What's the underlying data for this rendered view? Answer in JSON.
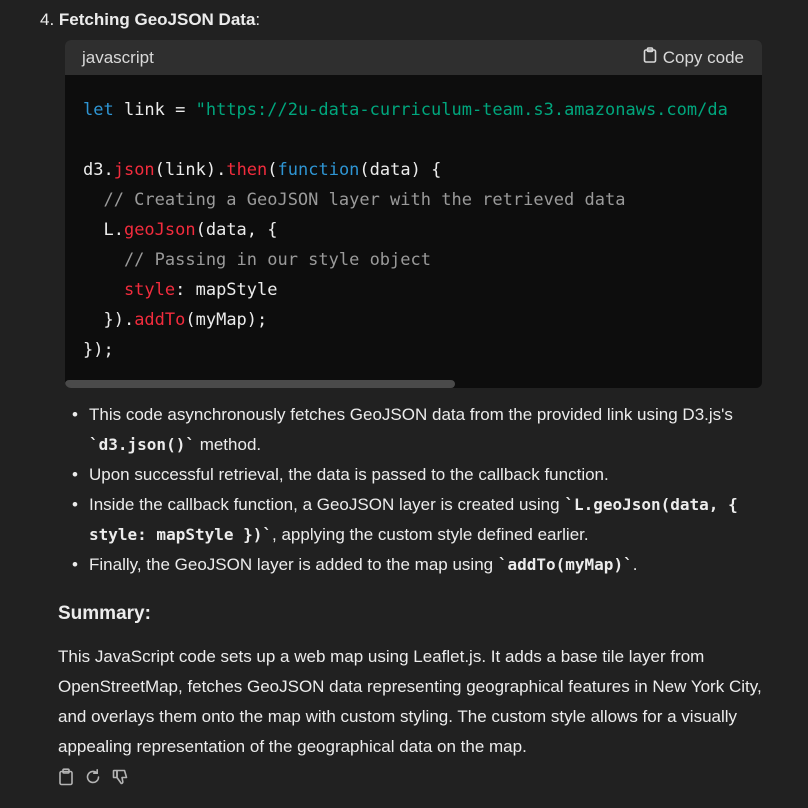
{
  "step": {
    "number": "4.",
    "title": "Fetching GeoJSON Data",
    "colon": ":"
  },
  "code": {
    "language": "javascript",
    "copy_label": "Copy code",
    "l1_kw": "let",
    "l1_var": " link = ",
    "l1_str": "\"https://2u-data-curriculum-team.s3.amazonaws.com/da",
    "l2_obj": "d3.",
    "l2_fn": "json",
    "l2_mid": "(link).",
    "l2_then": "then",
    "l2_paren": "(",
    "l2_function": "function",
    "l2_end": "(data) {",
    "l3_cmt": "  // Creating a GeoJSON layer with the retrieved data",
    "l4_obj": "  L.",
    "l4_fn": "geoJson",
    "l4_end": "(data, {",
    "l5_cmt": "    // Passing in our style object",
    "l6_key": "    style",
    "l6_end": ": mapStyle",
    "l7_start": "  }).",
    "l7_fn": "addTo",
    "l7_end": "(myMap);",
    "l8": "});"
  },
  "bullets": {
    "b1_a": "This code asynchronously fetches GeoJSON data from the provided link using D3.js's ",
    "b1_code": "`d3.json()`",
    "b1_b": " method.",
    "b2": "Upon successful retrieval, the data is passed to the callback function.",
    "b3_a": "Inside the callback function, a GeoJSON layer is created using ",
    "b3_code": "`L.geoJson(data, { style: mapStyle })`",
    "b3_b": ", applying the custom style defined earlier.",
    "b4_a": "Finally, the GeoJSON layer is added to the map using ",
    "b4_code": "`addTo(myMap)`",
    "b4_b": "."
  },
  "summary": {
    "title": "Summary:",
    "text": "This JavaScript code sets up a web map using Leaflet.js. It adds a base tile layer from OpenStreetMap, fetches GeoJSON data representing geographical features in New York City, and overlays them onto the map with custom styling. The custom style allows for a visually appealing representation of the geographical data on the map."
  },
  "icons": {
    "copy": "clipboard-icon",
    "regenerate": "regenerate-icon",
    "dislike": "thumbs-down-icon"
  }
}
